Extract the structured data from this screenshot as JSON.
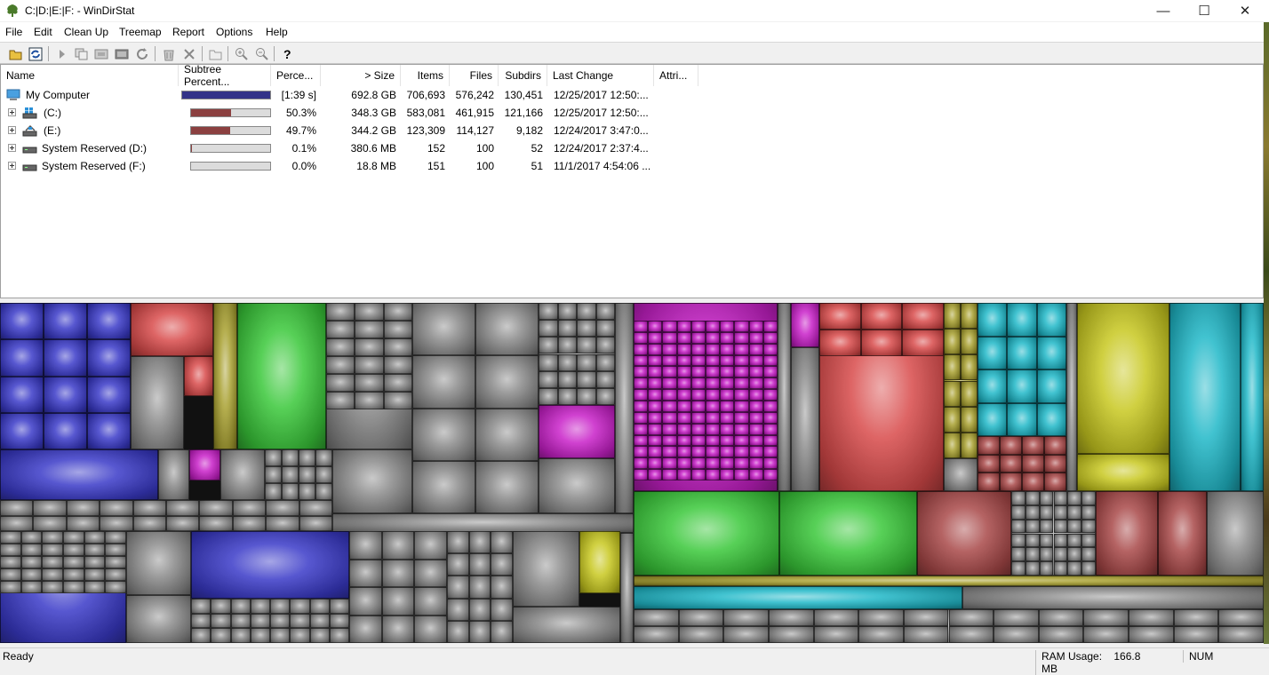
{
  "window": {
    "title": "C:|D:|E:|F: - WinDirStat",
    "minimize_glyph": "—",
    "maximize_glyph": "☐",
    "close_glyph": "✕"
  },
  "menu": {
    "items": [
      "File",
      "Edit",
      "Clean Up",
      "Treemap",
      "Report",
      "Options",
      "Help"
    ]
  },
  "toolbar": {
    "buttons": [
      {
        "icon": "open-folder-icon"
      },
      {
        "icon": "refresh-all-icon"
      },
      {
        "icon": "expand-icon"
      },
      {
        "icon": "copy-path-icon"
      },
      {
        "icon": "explorer-icon"
      },
      {
        "icon": "command-prompt-icon"
      },
      {
        "icon": "refresh-icon"
      },
      {
        "icon": "recycle-icon"
      },
      {
        "icon": "delete-icon"
      },
      {
        "icon": "properties-icon"
      },
      {
        "icon": "zoom-in-icon"
      },
      {
        "icon": "zoom-out-icon"
      },
      {
        "icon": "help-icon"
      }
    ]
  },
  "list": {
    "columns": [
      "Name",
      "Subtree Percent...",
      "Perce...",
      "> Size",
      "Items",
      "Files",
      "Subdirs",
      "Last Change",
      "Attri..."
    ],
    "rows": [
      {
        "name": "My Computer",
        "icon": "computer-icon",
        "bar_fraction": 1.0,
        "bar_color": "#333388",
        "percent": "[1:39 s]",
        "size": "692.8 GB",
        "items": "706,693",
        "files": "576,242",
        "subdirs": "130,451",
        "last_change": "12/25/2017  12:50:...",
        "expandable": false
      },
      {
        "name": "(C:)",
        "icon": "windows-drive-icon",
        "bar_fraction": 0.503,
        "bar_color": "#8b4040",
        "percent": "50.3%",
        "size": "348.3 GB",
        "items": "583,081",
        "files": "461,915",
        "subdirs": "121,166",
        "last_change": "12/25/2017  12:50:...",
        "expandable": true
      },
      {
        "name": "(E:)",
        "icon": "shared-drive-icon",
        "bar_fraction": 0.497,
        "bar_color": "#8b4040",
        "percent": "49.7%",
        "size": "344.2 GB",
        "items": "123,309",
        "files": "114,127",
        "subdirs": "9,182",
        "last_change": "12/24/2017  3:47:0...",
        "expandable": true
      },
      {
        "name": "System Reserved (D:)",
        "icon": "drive-icon",
        "bar_fraction": 0.001,
        "bar_color": "#8b4040",
        "percent": "0.1%",
        "size": "380.6 MB",
        "items": "152",
        "files": "100",
        "subdirs": "52",
        "last_change": "12/24/2017  2:37:4...",
        "expandable": true
      },
      {
        "name": "System Reserved (F:)",
        "icon": "drive-icon",
        "bar_fraction": 0.0,
        "bar_color": "#8b4040",
        "percent": "0.0%",
        "size": "18.8 MB",
        "items": "151",
        "files": "100",
        "subdirs": "51",
        "last_change": "11/1/2017  4:54:06 ...",
        "expandable": true
      }
    ]
  },
  "status": {
    "ready": "Ready",
    "ram_label": "RAM Usage:",
    "ram_value": "166.8 MB",
    "num": "NUM"
  },
  "treemap_colors": {
    "blue": "#3a3ac8",
    "red": "#d84a4a",
    "green": "#3ac83a",
    "gray": "#8a8a8a",
    "magenta": "#c820c8",
    "yellow": "#c8c820",
    "cyan": "#20b8c8",
    "olive": "#a8a030",
    "maroon": "#a84848"
  }
}
